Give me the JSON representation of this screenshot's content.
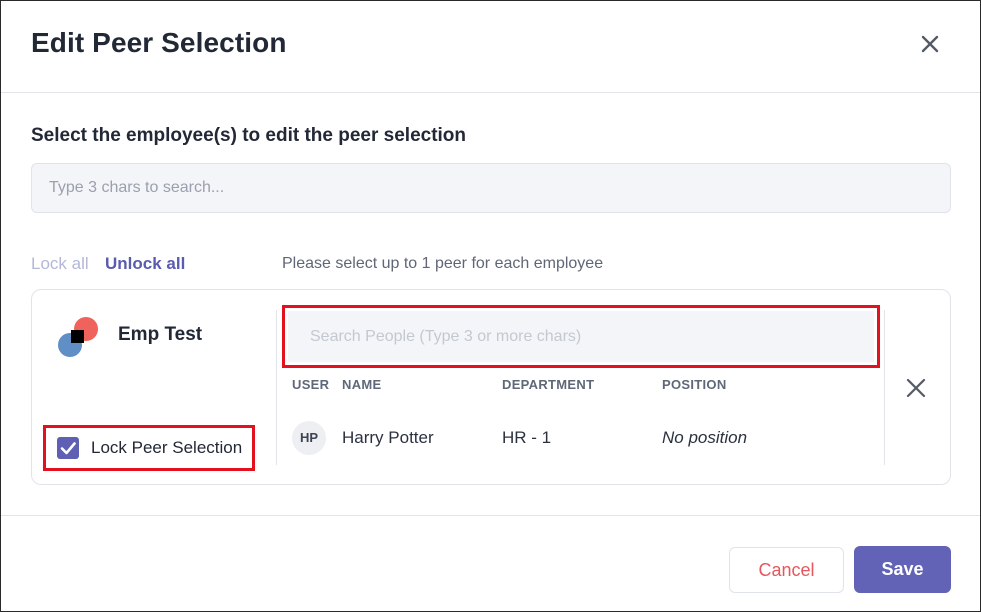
{
  "dialog": {
    "title": "Edit Peer Selection",
    "close_icon": "close-icon"
  },
  "employee_section": {
    "heading": "Select the employee(s) to edit the peer selection",
    "search_placeholder": "Type 3 chars to search..."
  },
  "actions": {
    "lock_all": "Lock all",
    "unlock_all": "Unlock all",
    "hint": "Please select up to 1 peer for each employee"
  },
  "employee_card": {
    "name": "Emp Test",
    "avatar_icon": "avatar-icon",
    "lock_checkbox_checked": true,
    "lock_label": "Lock Peer Selection",
    "people_search_placeholder": "Search People (Type 3 or more chars)",
    "columns": [
      "USER",
      "NAME",
      "DEPARTMENT",
      "POSITION"
    ],
    "rows": [
      {
        "initials": "HP",
        "name": "Harry Potter",
        "department": "HR - 1",
        "position": "No position"
      }
    ],
    "remove_icon": "close-icon"
  },
  "footer": {
    "cancel_label": "Cancel",
    "save_label": "Save"
  },
  "colors": {
    "accent": "#6262b6",
    "cancel_text": "#e5565d",
    "highlight_border": "#e3101e"
  }
}
